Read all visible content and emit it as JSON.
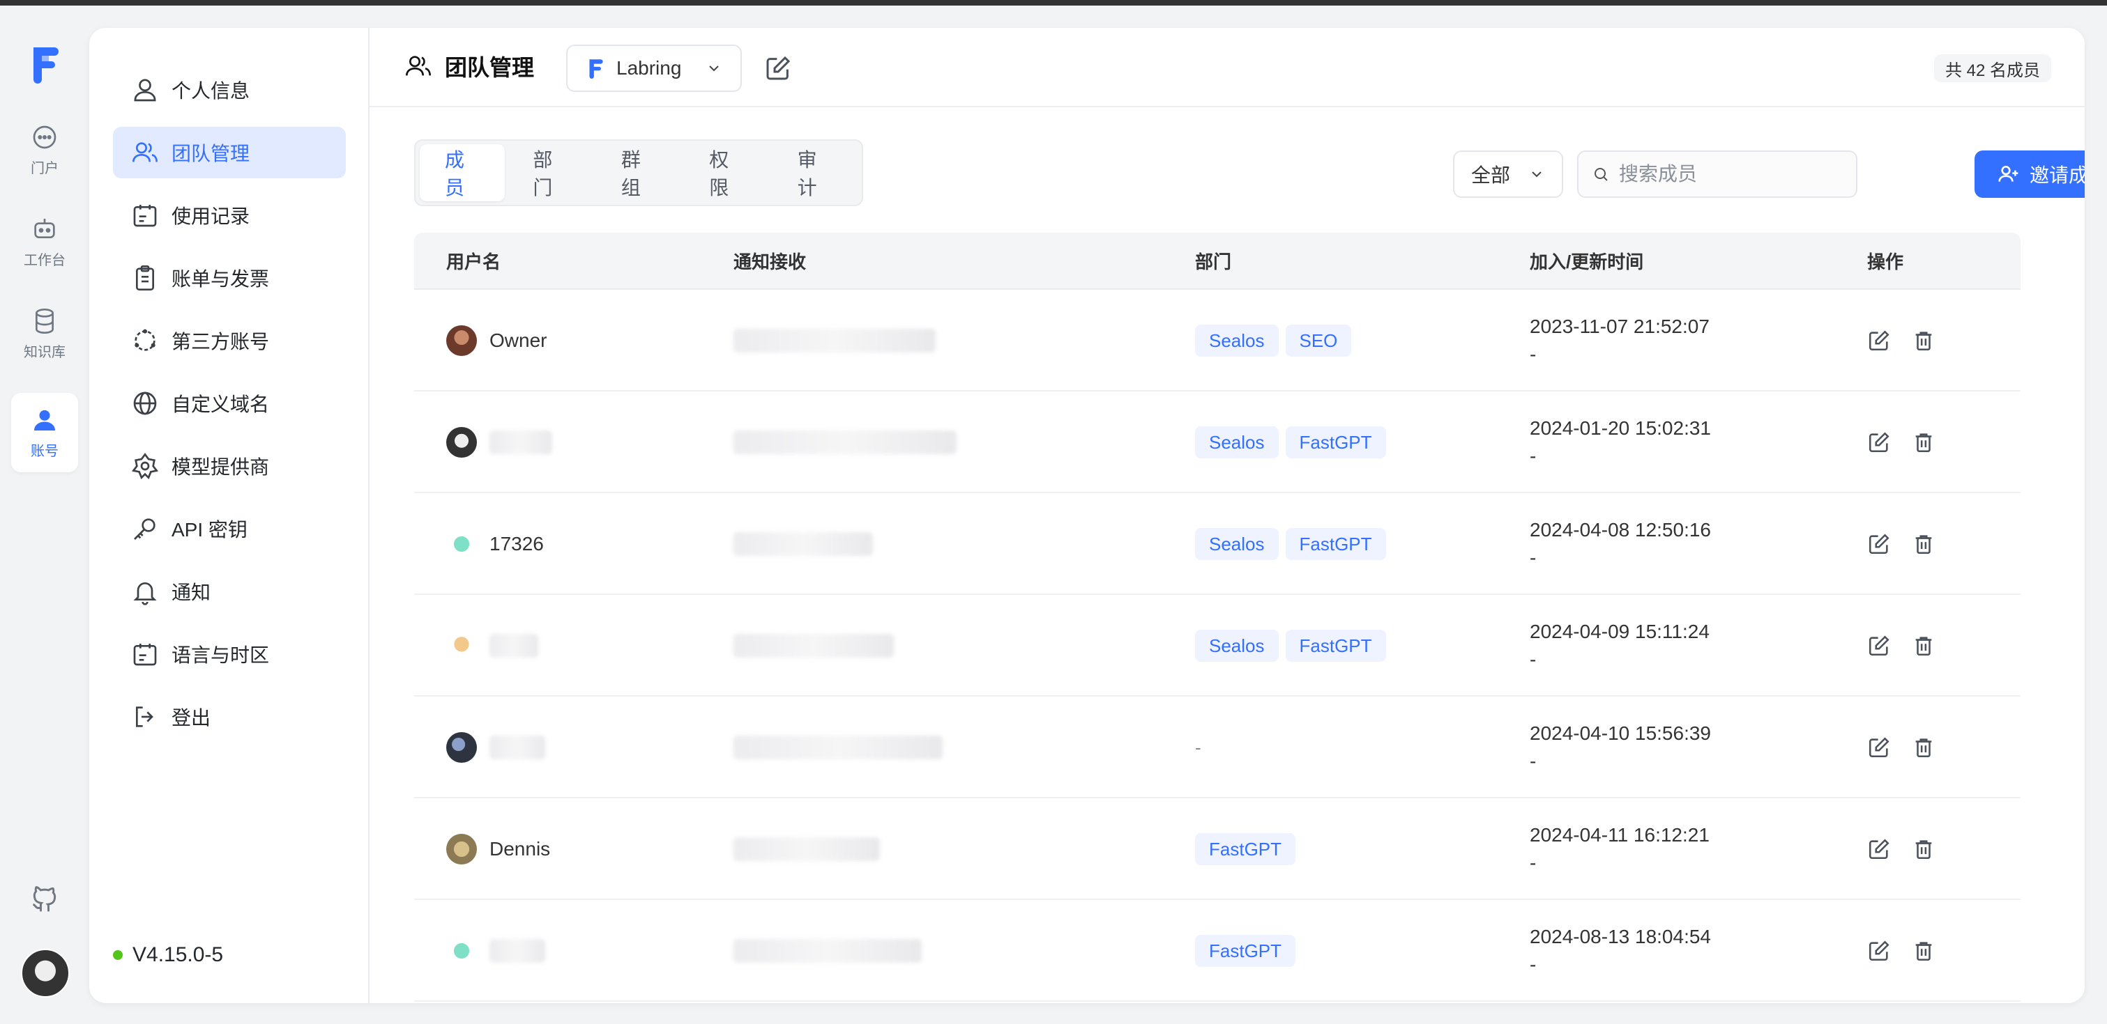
{
  "rail": {
    "items": [
      {
        "label": "门户",
        "icon": "chat-bubble-icon"
      },
      {
        "label": "工作台",
        "icon": "robot-icon"
      },
      {
        "label": "知识库",
        "icon": "database-icon"
      },
      {
        "label": "账号",
        "icon": "user-icon",
        "active": true
      }
    ]
  },
  "subnav": {
    "items": [
      {
        "label": "个人信息",
        "icon": "user-icon"
      },
      {
        "label": "团队管理",
        "icon": "team-icon",
        "active": true
      },
      {
        "label": "使用记录",
        "icon": "calendar-icon"
      },
      {
        "label": "账单与发票",
        "icon": "clipboard-icon"
      },
      {
        "label": "第三方账号",
        "icon": "share-nodes-icon"
      },
      {
        "label": "自定义域名",
        "icon": "globe-icon"
      },
      {
        "label": "模型提供商",
        "icon": "model-icon"
      },
      {
        "label": "API 密钥",
        "icon": "key-icon"
      },
      {
        "label": "通知",
        "icon": "bell-icon"
      },
      {
        "label": "语言与时区",
        "icon": "calendar-icon"
      },
      {
        "label": "登出",
        "icon": "logout-icon"
      }
    ],
    "version": "V4.15.0-5"
  },
  "header": {
    "title": "团队管理",
    "team_name": "Labring",
    "member_count": "共 42 名成员"
  },
  "tabs": [
    "成员",
    "部门",
    "群组",
    "权限",
    "审计"
  ],
  "filter": {
    "selected": "全部"
  },
  "search": {
    "placeholder": "搜索成员"
  },
  "invite_label": "邀请成员",
  "table": {
    "columns": [
      "用户名",
      "通知接收",
      "部门",
      "加入/更新时间",
      "操作"
    ],
    "rows": [
      {
        "name": "Owner",
        "depts": [
          "Sealos",
          "SEO"
        ],
        "time": "2023-11-07 21:52:07",
        "time2": "-"
      },
      {
        "name": "",
        "depts": [
          "Sealos",
          "FastGPT"
        ],
        "time": "2024-01-20 15:02:31",
        "time2": "-"
      },
      {
        "name": "17326",
        "depts": [
          "Sealos",
          "FastGPT"
        ],
        "time": "2024-04-08 12:50:16",
        "time2": "-"
      },
      {
        "name": "",
        "depts": [
          "Sealos",
          "FastGPT"
        ],
        "time": "2024-04-09 15:11:24",
        "time2": "-"
      },
      {
        "name": "",
        "depts": [],
        "dept_dash": "-",
        "time": "2024-04-10 15:56:39",
        "time2": "-"
      },
      {
        "name": "Dennis",
        "depts": [
          "FastGPT"
        ],
        "time": "2024-04-11 16:12:21",
        "time2": "-"
      },
      {
        "name": "",
        "depts": [
          "FastGPT"
        ],
        "time": "2024-08-13 18:04:54",
        "time2": "-"
      }
    ]
  },
  "colors": {
    "accent": "#3370ff",
    "tag_bg": "#eef3ff",
    "status_online": "#52c41a"
  }
}
